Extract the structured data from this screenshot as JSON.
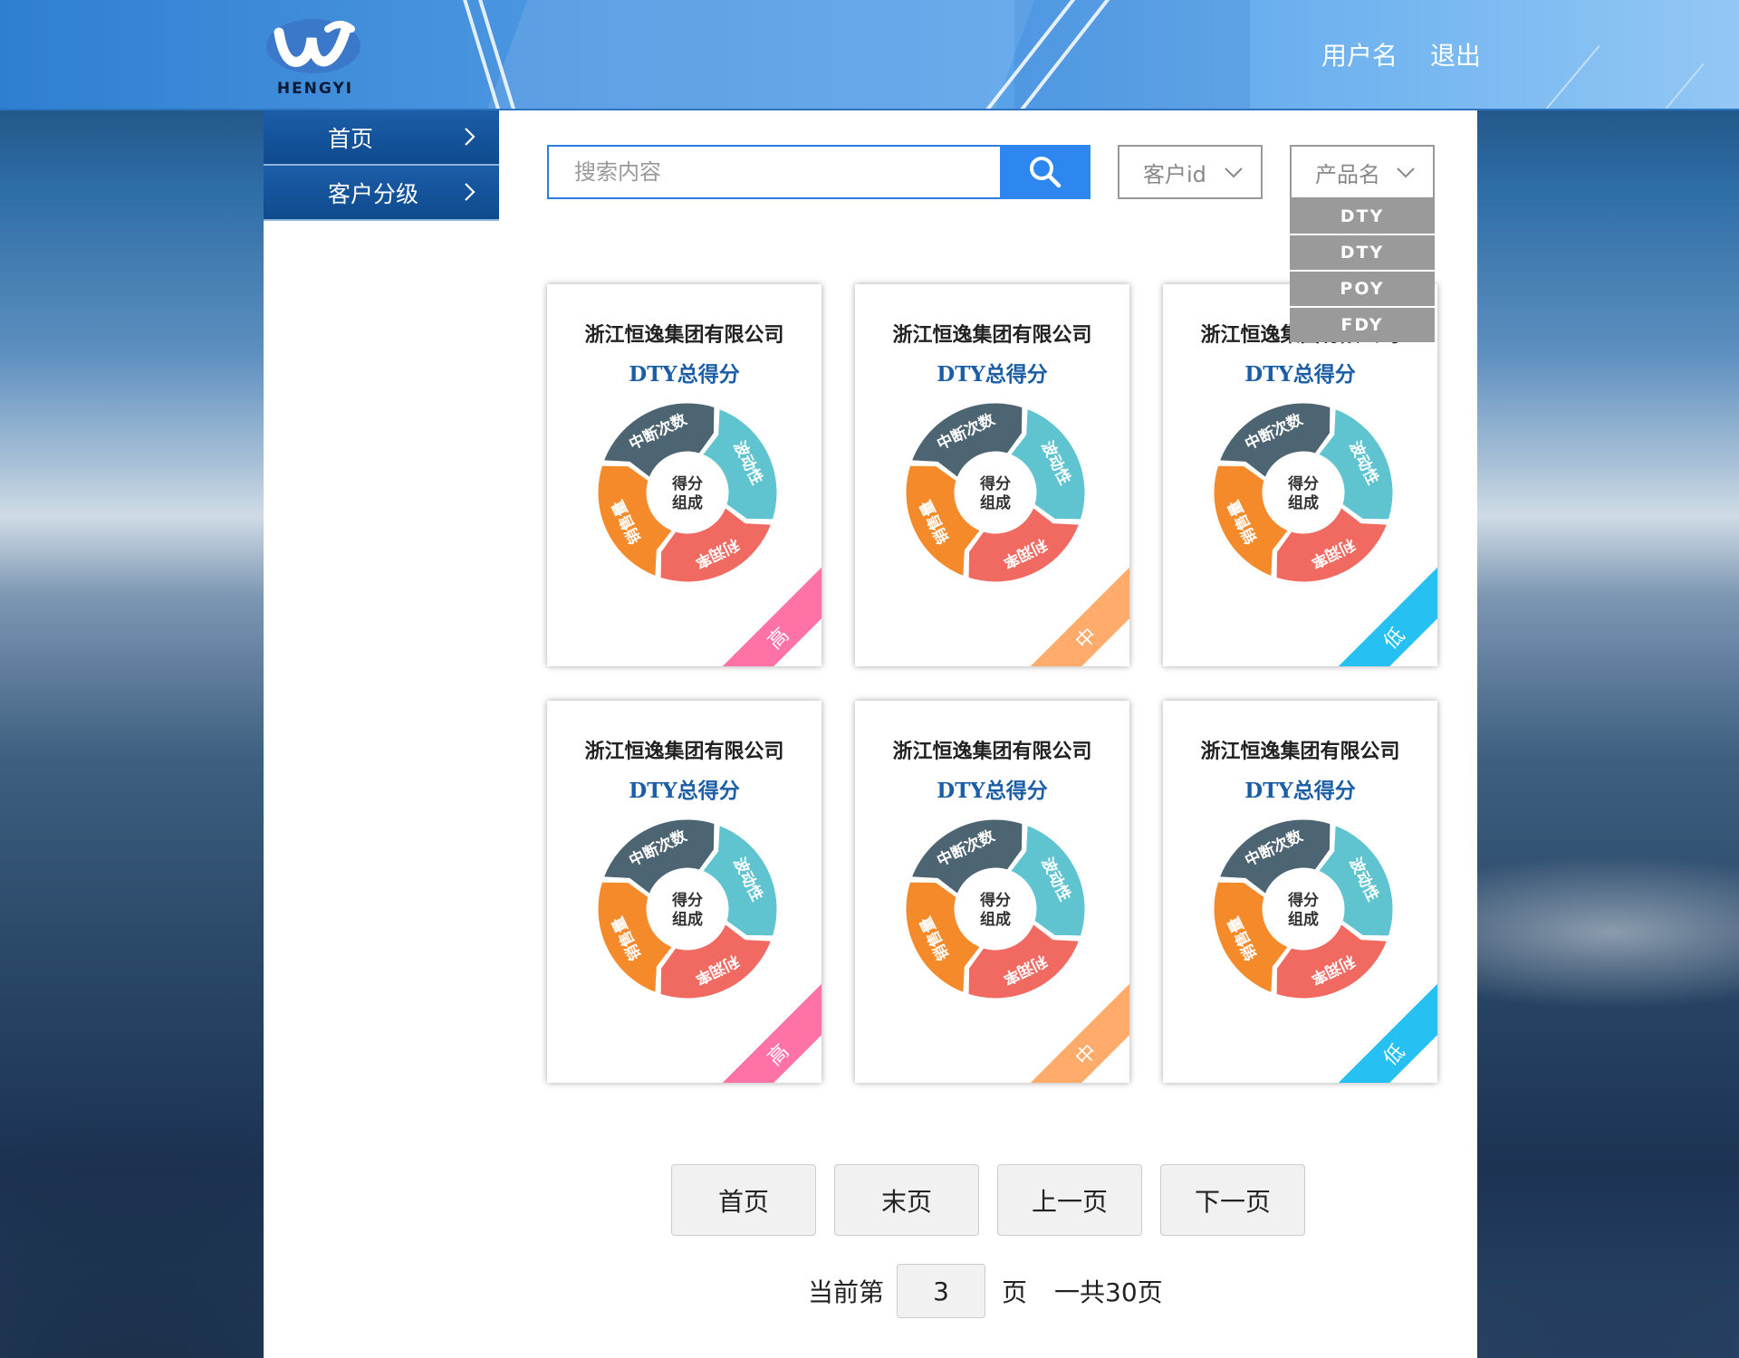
{
  "logo": {
    "text": "HENGYI"
  },
  "header": {
    "username": "用户名",
    "logout": "退出"
  },
  "sidebar": {
    "items": [
      {
        "label": "首页"
      },
      {
        "label": "客户分级"
      }
    ]
  },
  "search": {
    "placeholder": "搜索内容",
    "value": ""
  },
  "filters": {
    "customer_id": {
      "label": "客户id"
    },
    "product": {
      "label": "产品名",
      "options": [
        "DTY",
        "DTY",
        "POY",
        "FDY"
      ],
      "expanded": true
    }
  },
  "donut_labels": {
    "center_line1": "得分",
    "center_line2": "组成",
    "segments": [
      "中断次数",
      "波动性",
      "利润率",
      "销售量"
    ]
  },
  "segment_colors": [
    "#4d6472",
    "#5fc4d0",
    "#f06a62",
    "#f58a2b"
  ],
  "cards": [
    {
      "company": "浙江恒逸集团有限公司",
      "score_title": "DTY总得分",
      "level": "高",
      "level_color": "#ff72a6"
    },
    {
      "company": "浙江恒逸集团有限公司",
      "score_title": "DTY总得分",
      "level": "中",
      "level_color": "#ffab6b"
    },
    {
      "company": "浙江恒逸集团有限公司",
      "score_title": "DTY总得分",
      "level": "低",
      "level_color": "#26c1f2"
    },
    {
      "company": "浙江恒逸集团有限公司",
      "score_title": "DTY总得分",
      "level": "高",
      "level_color": "#ff72a6"
    },
    {
      "company": "浙江恒逸集团有限公司",
      "score_title": "DTY总得分",
      "level": "中",
      "level_color": "#ffab6b"
    },
    {
      "company": "浙江恒逸集团有限公司",
      "score_title": "DTY总得分",
      "level": "低",
      "level_color": "#26c1f2"
    }
  ],
  "pagination": {
    "first": "首页",
    "last": "末页",
    "prev": "上一页",
    "next": "下一页",
    "current_prefix": "当前第",
    "current_page": "3",
    "current_suffix": "页",
    "total": "一共30页"
  }
}
